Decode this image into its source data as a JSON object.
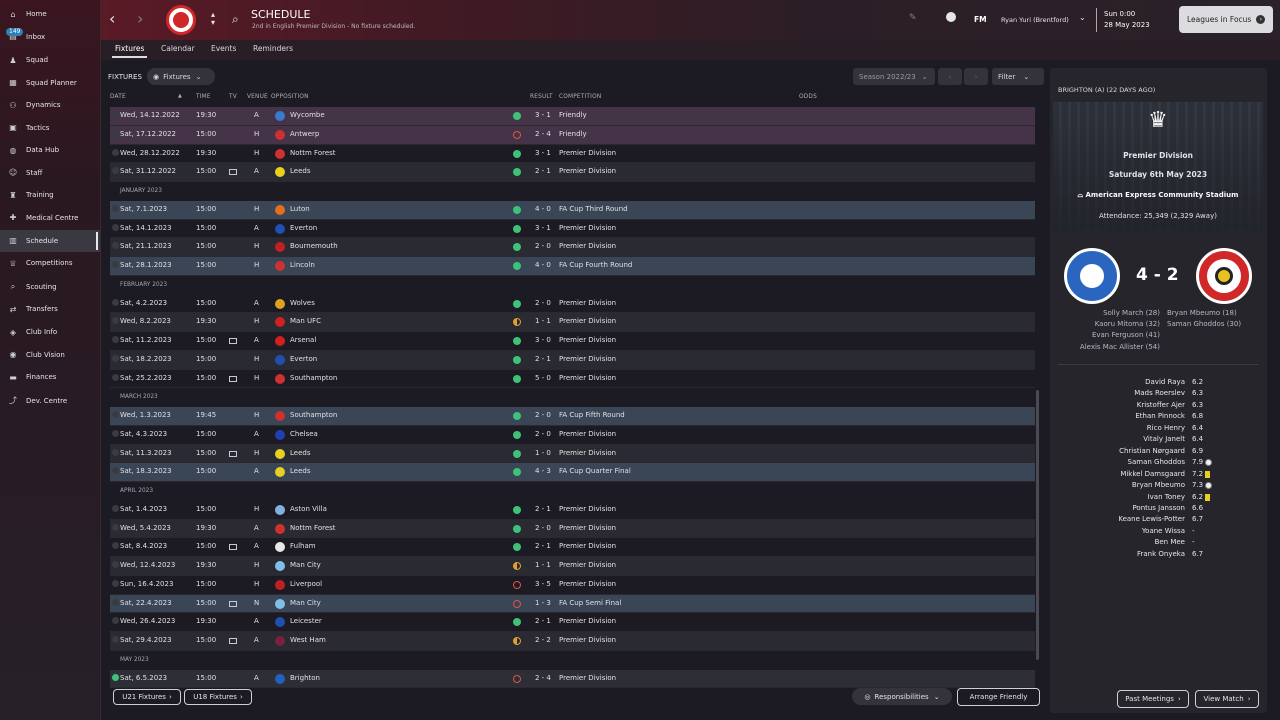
{
  "sidebar": {
    "inbox_count": "149",
    "items": [
      {
        "label": "Home",
        "icon": "home-icon",
        "glyph": "⌂"
      },
      {
        "label": "Inbox",
        "icon": "inbox-icon",
        "glyph": "▤"
      },
      {
        "label": "Squad",
        "icon": "shirt-icon",
        "glyph": "♟"
      },
      {
        "label": "Squad Planner",
        "icon": "planner-icon",
        "glyph": "▦"
      },
      {
        "label": "Dynamics",
        "icon": "dynamics-icon",
        "glyph": "⚇"
      },
      {
        "label": "Tactics",
        "icon": "tactics-icon",
        "glyph": "▣"
      },
      {
        "label": "Data Hub",
        "icon": "data-hub-icon",
        "glyph": "◍"
      },
      {
        "label": "Staff",
        "icon": "staff-icon",
        "glyph": "☺"
      },
      {
        "label": "Training",
        "icon": "training-icon",
        "glyph": "♜"
      },
      {
        "label": "Medical Centre",
        "icon": "medical-icon",
        "glyph": "✚"
      },
      {
        "label": "Schedule",
        "icon": "schedule-icon",
        "glyph": "▥"
      },
      {
        "label": "Competitions",
        "icon": "trophy-icon",
        "glyph": "♕"
      },
      {
        "label": "Scouting",
        "icon": "scouting-icon",
        "glyph": "⌕"
      },
      {
        "label": "Transfers",
        "icon": "transfers-icon",
        "glyph": "⇄"
      },
      {
        "label": "Club Info",
        "icon": "club-info-icon",
        "glyph": "◈"
      },
      {
        "label": "Club Vision",
        "icon": "club-vision-icon",
        "glyph": "◉"
      },
      {
        "label": "Finances",
        "icon": "finances-icon",
        "glyph": "▬"
      },
      {
        "label": "Dev. Centre",
        "icon": "dev-centre-icon",
        "glyph": "⤴"
      }
    ]
  },
  "header": {
    "title": "SCHEDULE",
    "subtitle": "2nd in English Premier Division - No fixture scheduled.",
    "fm_label": "FM",
    "manager": "Ryan Yuri (Brentford)",
    "date_line1": "Sun 0:00",
    "date_line2": "28 May 2023",
    "leagues_button": "Leagues in Focus"
  },
  "tabs": [
    "Fixtures",
    "Calendar",
    "Events",
    "Reminders"
  ],
  "fixtures_bar": {
    "label": "FIXTURES",
    "view_dropdown": "Fixtures",
    "season": "Season 2022/23",
    "filter": "Filter"
  },
  "columns": {
    "date": "DATE",
    "time": "TIME",
    "tv": "TV",
    "venue": "VENUE",
    "opposition": "OPPOSITION",
    "result": "RESULT",
    "competition": "COMPETITION",
    "odds": "ODDS"
  },
  "rows": [
    {
      "kind": "match",
      "style": "fri",
      "date": "Wed, 14.12.2022",
      "time": "19:30",
      "tv": false,
      "venue": "A",
      "opp": "Wycombe",
      "crest": "#3a7acc",
      "res": "win",
      "score": "3 - 1",
      "comp": "Friendly"
    },
    {
      "kind": "match",
      "style": "fri",
      "date": "Sat, 17.12.2022",
      "time": "15:00",
      "tv": false,
      "venue": "H",
      "opp": "Antwerp",
      "crest": "#cc3030",
      "res": "loss",
      "score": "2 - 4",
      "comp": "Friendly"
    },
    {
      "kind": "match",
      "style": "",
      "date": "Wed, 28.12.2022",
      "time": "19:30",
      "tv": false,
      "venue": "H",
      "opp": "Nottm Forest",
      "crest": "#d03030",
      "res": "win",
      "score": "3 - 1",
      "comp": "Premier Division"
    },
    {
      "kind": "match",
      "style": "alt",
      "date": "Sat, 31.12.2022",
      "time": "15:00",
      "tv": true,
      "venue": "A",
      "opp": "Leeds",
      "crest": "#e8d020",
      "res": "win",
      "score": "2 - 1",
      "comp": "Premier Division"
    },
    {
      "kind": "month",
      "label": "JANUARY 2023"
    },
    {
      "kind": "match",
      "style": "cup",
      "date": "Sat, 7.1.2023",
      "time": "15:00",
      "tv": false,
      "venue": "H",
      "opp": "Luton",
      "crest": "#e07020",
      "res": "win",
      "score": "4 - 0",
      "comp": "FA Cup Third Round"
    },
    {
      "kind": "match",
      "style": "",
      "date": "Sat, 14.1.2023",
      "time": "15:00",
      "tv": false,
      "venue": "A",
      "opp": "Everton",
      "crest": "#2050b0",
      "res": "win",
      "score": "3 - 1",
      "comp": "Premier Division"
    },
    {
      "kind": "match",
      "style": "alt",
      "date": "Sat, 21.1.2023",
      "time": "15:00",
      "tv": false,
      "venue": "H",
      "opp": "Bournemouth",
      "crest": "#c02020",
      "res": "win",
      "score": "2 - 0",
      "comp": "Premier Division"
    },
    {
      "kind": "match",
      "style": "cup",
      "date": "Sat, 28.1.2023",
      "time": "15:00",
      "tv": false,
      "venue": "H",
      "opp": "Lincoln",
      "crest": "#d03030",
      "res": "win",
      "score": "4 - 0",
      "comp": "FA Cup Fourth Round"
    },
    {
      "kind": "month",
      "label": "FEBRUARY 2023"
    },
    {
      "kind": "match",
      "style": "",
      "date": "Sat, 4.2.2023",
      "time": "15:00",
      "tv": false,
      "venue": "A",
      "opp": "Wolves",
      "crest": "#e0a020",
      "res": "win",
      "score": "2 - 0",
      "comp": "Premier Division"
    },
    {
      "kind": "match",
      "style": "alt",
      "date": "Wed, 8.2.2023",
      "time": "19:30",
      "tv": false,
      "venue": "H",
      "opp": "Man UFC",
      "crest": "#d02020",
      "res": "draw",
      "score": "1 - 1",
      "comp": "Premier Division"
    },
    {
      "kind": "match",
      "style": "",
      "date": "Sat, 11.2.2023",
      "time": "15:00",
      "tv": true,
      "venue": "A",
      "opp": "Arsenal",
      "crest": "#d02020",
      "res": "win",
      "score": "3 - 0",
      "comp": "Premier Division"
    },
    {
      "kind": "match",
      "style": "alt",
      "date": "Sat, 18.2.2023",
      "time": "15:00",
      "tv": false,
      "venue": "H",
      "opp": "Everton",
      "crest": "#2050b0",
      "res": "win",
      "score": "2 - 1",
      "comp": "Premier Division"
    },
    {
      "kind": "match",
      "style": "",
      "date": "Sat, 25.2.2023",
      "time": "15:00",
      "tv": true,
      "venue": "H",
      "opp": "Southampton",
      "crest": "#d03030",
      "res": "win",
      "score": "5 - 0",
      "comp": "Premier Division"
    },
    {
      "kind": "month",
      "label": "MARCH 2023"
    },
    {
      "kind": "match",
      "style": "cup",
      "date": "Wed, 1.3.2023",
      "time": "19:45",
      "tv": false,
      "venue": "H",
      "opp": "Southampton",
      "crest": "#d03030",
      "res": "win",
      "score": "2 - 0",
      "comp": "FA Cup Fifth Round"
    },
    {
      "kind": "match",
      "style": "",
      "date": "Sat, 4.3.2023",
      "time": "15:00",
      "tv": false,
      "venue": "A",
      "opp": "Chelsea",
      "crest": "#2040b0",
      "res": "win",
      "score": "2 - 0",
      "comp": "Premier Division"
    },
    {
      "kind": "match",
      "style": "alt",
      "date": "Sat, 11.3.2023",
      "time": "15:00",
      "tv": true,
      "venue": "H",
      "opp": "Leeds",
      "crest": "#e8d020",
      "res": "win",
      "score": "1 - 0",
      "comp": "Premier Division"
    },
    {
      "kind": "match",
      "style": "cup",
      "date": "Sat, 18.3.2023",
      "time": "15:00",
      "tv": false,
      "venue": "A",
      "opp": "Leeds",
      "crest": "#e8d020",
      "res": "win",
      "score": "4 - 3",
      "comp": "FA Cup Quarter Final"
    },
    {
      "kind": "month",
      "label": "APRIL 2023"
    },
    {
      "kind": "match",
      "style": "",
      "date": "Sat, 1.4.2023",
      "time": "15:00",
      "tv": false,
      "venue": "H",
      "opp": "Aston Villa",
      "crest": "#80b0e0",
      "res": "win",
      "score": "2 - 1",
      "comp": "Premier Division"
    },
    {
      "kind": "match",
      "style": "alt",
      "date": "Wed, 5.4.2023",
      "time": "19:30",
      "tv": false,
      "venue": "A",
      "opp": "Nottm Forest",
      "crest": "#d03030",
      "res": "win",
      "score": "2 - 0",
      "comp": "Premier Division"
    },
    {
      "kind": "match",
      "style": "",
      "date": "Sat, 8.4.2023",
      "time": "15:00",
      "tv": true,
      "venue": "A",
      "opp": "Fulham",
      "crest": "#e8e8e8",
      "res": "win",
      "score": "2 - 1",
      "comp": "Premier Division"
    },
    {
      "kind": "match",
      "style": "alt",
      "date": "Wed, 12.4.2023",
      "time": "19:30",
      "tv": false,
      "venue": "H",
      "opp": "Man City",
      "crest": "#80c0e8",
      "res": "draw",
      "score": "1 - 1",
      "comp": "Premier Division"
    },
    {
      "kind": "match",
      "style": "",
      "date": "Sun, 16.4.2023",
      "time": "15:00",
      "tv": false,
      "venue": "H",
      "opp": "Liverpool",
      "crest": "#c02020",
      "res": "loss",
      "score": "3 - 5",
      "comp": "Premier Division"
    },
    {
      "kind": "match",
      "style": "cup",
      "date": "Sat, 22.4.2023",
      "time": "15:00",
      "tv": true,
      "venue": "N",
      "opp": "Man City",
      "crest": "#80c0e8",
      "res": "loss",
      "score": "1 - 3",
      "comp": "FA Cup Semi Final"
    },
    {
      "kind": "match",
      "style": "",
      "date": "Wed, 26.4.2023",
      "time": "19:30",
      "tv": false,
      "venue": "A",
      "opp": "Leicester",
      "crest": "#2050b0",
      "res": "win",
      "score": "2 - 1",
      "comp": "Premier Division"
    },
    {
      "kind": "match",
      "style": "alt",
      "date": "Sat, 29.4.2023",
      "time": "15:00",
      "tv": true,
      "venue": "A",
      "opp": "West Ham",
      "crest": "#7a2040",
      "res": "draw",
      "score": "2 - 2",
      "comp": "Premier Division"
    },
    {
      "kind": "month",
      "label": "MAY 2023"
    },
    {
      "kind": "match",
      "style": "sel",
      "date": "Sat, 6.5.2023",
      "time": "15:00",
      "tv": false,
      "venue": "A",
      "opp": "Brighton",
      "crest": "#2060c0",
      "res": "loss",
      "score": "2 - 4",
      "comp": "Premier Division"
    }
  ],
  "panel": {
    "heading": "BRIGHTON (A) (22 DAYS AGO)",
    "competition": "Premier Division",
    "date": "Saturday 6th May 2023",
    "stadium": "American Express Community Stadium",
    "attendance": "Attendance: 25,349 (2,329 Away)",
    "score": "4 - 2",
    "home_scorers": [
      "Solly March (28)",
      "Kaoru Mitoma (32)",
      "Evan Ferguson (41)",
      "Alexis Mac Allister (54)"
    ],
    "away_scorers": [
      "Bryan Mbeumo (18)",
      "Saman Ghoddos (30)"
    ],
    "players": [
      {
        "name": "David Raya",
        "rating": "6.2",
        "icon": ""
      },
      {
        "name": "Mads Roerslev",
        "rating": "6.3",
        "icon": ""
      },
      {
        "name": "Kristoffer Ajer",
        "rating": "6.3",
        "icon": ""
      },
      {
        "name": "Ethan Pinnock",
        "rating": "6.8",
        "icon": ""
      },
      {
        "name": "Rico Henry",
        "rating": "6.4",
        "icon": ""
      },
      {
        "name": "Vitaly Janelt",
        "rating": "6.4",
        "icon": ""
      },
      {
        "name": "Christian Nørgaard",
        "rating": "6.9",
        "icon": ""
      },
      {
        "name": "Saman Ghoddos",
        "rating": "7.9",
        "icon": "ball"
      },
      {
        "name": "Mikkel Damsgaard",
        "rating": "7.2",
        "icon": "card"
      },
      {
        "name": "Bryan Mbeumo",
        "rating": "7.3",
        "icon": "ball"
      },
      {
        "name": "Ivan Toney",
        "rating": "6.2",
        "icon": "card"
      },
      {
        "name": "Pontus Jansson",
        "rating": "6.6",
        "icon": ""
      },
      {
        "name": "Keane Lewis-Potter",
        "rating": "6.7",
        "icon": ""
      },
      {
        "name": "Yoane Wissa",
        "rating": "-",
        "icon": ""
      },
      {
        "name": "Ben Mee",
        "rating": "-",
        "icon": ""
      },
      {
        "name": "Frank Onyeka",
        "rating": "6.7",
        "icon": ""
      }
    ],
    "past_meetings": "Past Meetings",
    "view_match": "View Match"
  },
  "footer": {
    "u21": "U21 Fixtures",
    "u18": "U18 Fixtures",
    "responsibilities": "Responsibilities",
    "arrange": "Arrange Friendly"
  }
}
